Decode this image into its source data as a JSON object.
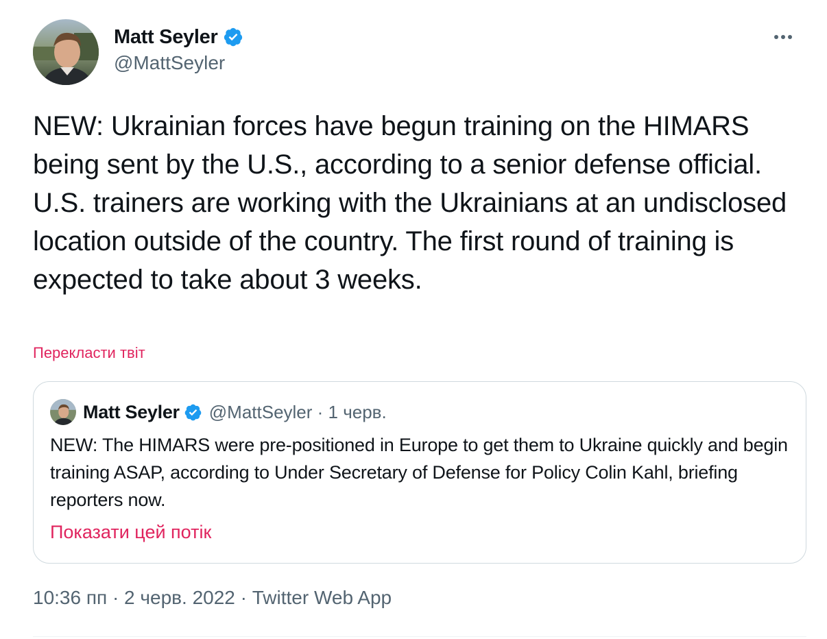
{
  "author": {
    "name": "Matt Seyler",
    "handle": "@MattSeyler"
  },
  "tweet": {
    "text": "NEW: Ukrainian forces have begun training on the HIMARS being sent by the U.S., according to a senior defense official. U.S. trainers are working with the Ukrainians at an undisclosed location outside of the country. The first round of training is expected to take about 3 weeks.",
    "translate_label": "Перекласти твіт",
    "timestamp": "10:36 пп · 2 черв. 2022 · Twitter Web App"
  },
  "quoted": {
    "name": "Matt Seyler",
    "meta": "@MattSeyler · 1 черв.",
    "text": "NEW: The HIMARS were pre-positioned in Europe to get them to Ukraine quickly and begin training ASAP, according to Under Secretary of Defense for Policy Colin Kahl, briefing reporters now.",
    "show_thread_label": "Показати цей потік"
  },
  "colors": {
    "verified": "#1d9bf0",
    "link": "#e0245e",
    "secondary_text": "#536471",
    "border": "#cfd9de"
  },
  "icons": {
    "verified": "verified-badge-icon",
    "more": "more-horizontal-icon"
  }
}
